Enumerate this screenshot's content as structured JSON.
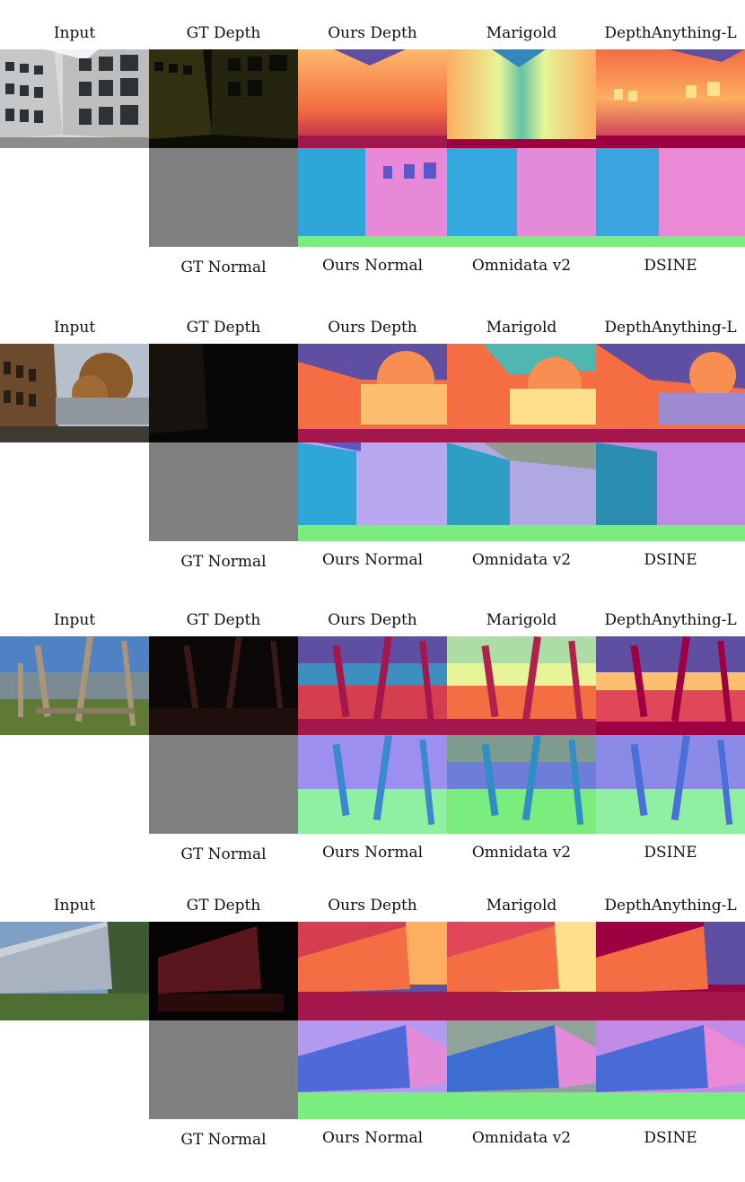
{
  "columns": {
    "input": "Input",
    "gt_depth": "GT Depth",
    "ours_depth": "Ours Depth",
    "marigold": "Marigold",
    "depthanything": "DepthAnything-L",
    "gt_normal": "GT Normal",
    "ours_normal": "Ours Normal",
    "omnidata": "Omnidata v2",
    "dsine": "DSINE"
  },
  "scenes": [
    {
      "description": "courtyard of white building"
    },
    {
      "description": "brick building and autumn tree"
    },
    {
      "description": "playground with wooden poles"
    },
    {
      "description": "long grey building with trees"
    }
  ],
  "colors": {
    "depth_near": "#a3174d",
    "depth_mid": "#f46d43",
    "depth_far": "#fdbf6f",
    "sky": "#5e4fa2",
    "normal_left": "#2fa6d8",
    "normal_right": "#e889d8",
    "normal_up": "#7bec7e",
    "gt_normal_gray": "#808080"
  }
}
